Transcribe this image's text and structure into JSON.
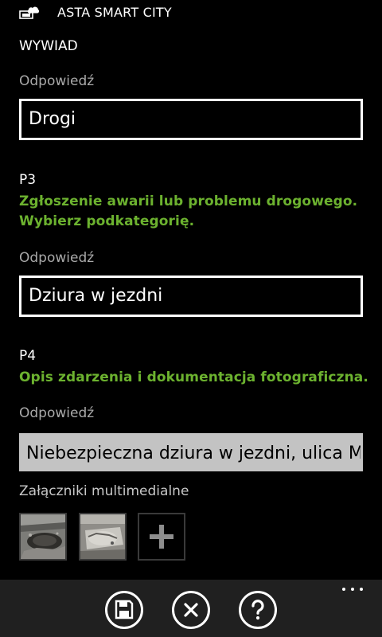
{
  "header": {
    "app_title": "ASTA SMART CITY",
    "app_icon": "cloud-device-icon"
  },
  "page": {
    "title": "WYWIAD"
  },
  "questions": [
    {
      "answer_label": "Odpowiedź",
      "answer_value": "Drogi"
    },
    {
      "id": "P3",
      "text_line1": "Zgłoszenie awarii lub problemu drogowego.",
      "text_line2": "Wybierz podkategorię.",
      "answer_label": "Odpowiedź",
      "answer_value": "Dziura w jezdni"
    },
    {
      "id": "P4",
      "text": "Opis zdarzenia i dokumentacja fotograficzna.",
      "answer_label": "Odpowiedź",
      "answer_value": "Niebezpieczna dziura w jezdni, ulica M"
    }
  ],
  "attachments": {
    "label": "Załączniki multimedialne",
    "items": [
      "pothole-photo-1",
      "pothole-photo-2"
    ],
    "add_icon": "plus-icon"
  },
  "app_bar": {
    "buttons": [
      "save-icon",
      "close-icon",
      "help-icon"
    ],
    "more_icon": "ellipsis-icon"
  },
  "colors": {
    "accent": "#6cb22f",
    "background": "#000000",
    "app_bar": "#202020",
    "label": "#a9a9a9"
  }
}
